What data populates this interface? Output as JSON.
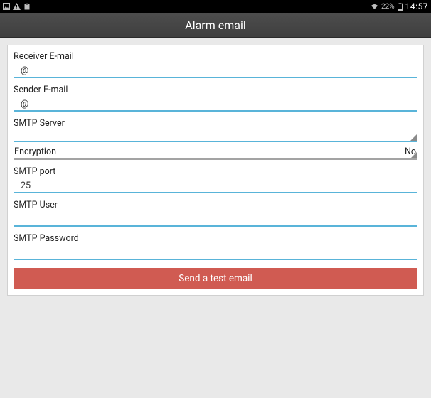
{
  "status": {
    "battery_pct": "22%",
    "time": "14:57"
  },
  "header": {
    "title": "Alarm email"
  },
  "form": {
    "receiver": {
      "label": "Receiver E-mail",
      "value": "@"
    },
    "sender": {
      "label": "Sender E-mail",
      "value": "@"
    },
    "smtp_server": {
      "label": "SMTP Server",
      "value": ""
    },
    "encryption": {
      "label": "Encryption",
      "value": "No"
    },
    "smtp_port": {
      "label": "SMTP port",
      "value": "25"
    },
    "smtp_user": {
      "label": "SMTP User",
      "value": ""
    },
    "smtp_password": {
      "label": "SMTP Password",
      "value": ""
    },
    "send_button": "Send a test email"
  },
  "colors": {
    "accent": "#59b4d9",
    "button": "#d05b52"
  }
}
